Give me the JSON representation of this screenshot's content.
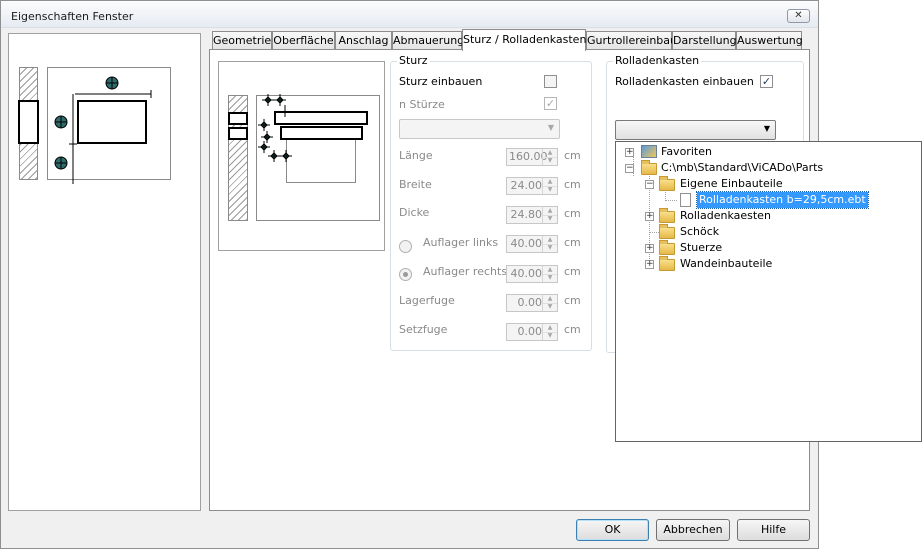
{
  "window": {
    "title": "Eigenschaften Fenster",
    "close_glyph": "✕"
  },
  "tabs": [
    {
      "label": "Geometrie"
    },
    {
      "label": "Oberfläche"
    },
    {
      "label": "Anschlag"
    },
    {
      "label": "Abmauerung"
    },
    {
      "label": "Sturz / Rolladenkasten",
      "active": true
    },
    {
      "label": "Gurtrollereinbau"
    },
    {
      "label": "Darstellung"
    },
    {
      "label": "Auswertung"
    }
  ],
  "sturz": {
    "title": "Sturz",
    "sturz_einbauen": {
      "label": "Sturz einbauen",
      "checked": false
    },
    "n_stuerze": {
      "label": "n Stürze",
      "checked": true,
      "disabled": true
    },
    "combo_value": "",
    "fields": [
      {
        "label": "Länge",
        "value": "160.00",
        "unit": "cm"
      },
      {
        "label": "Breite",
        "value": "24.00",
        "unit": "cm"
      },
      {
        "label": "Dicke",
        "value": "24.80",
        "unit": "cm"
      },
      {
        "label": "Auflager links",
        "value": "40.00",
        "unit": "cm",
        "radio": true,
        "selected": false
      },
      {
        "label": "Auflager rechts",
        "value": "40.00",
        "unit": "cm",
        "radio": true,
        "selected": true
      },
      {
        "label": "Lagerfuge",
        "value": "0.00",
        "unit": "cm"
      },
      {
        "label": "Setzfuge",
        "value": "0.00",
        "unit": "cm"
      }
    ]
  },
  "rolladenkasten": {
    "title": "Rolladenkasten",
    "einbauen": {
      "label": "Rolladenkasten einbauen",
      "checked": true
    },
    "combo_value": ""
  },
  "tree": [
    {
      "label": "Favoriten",
      "icon": "favorites-icon",
      "expander": "+"
    },
    {
      "label": "C:\\mb\\Standard\\ViCADo\\Parts",
      "icon": "folder-icon",
      "expander": "−"
    },
    {
      "label": "Eigene Einbauteile",
      "icon": "folder-icon",
      "expander": "−"
    },
    {
      "label": "Rolladenkasten b=29,5cm.ebt",
      "icon": "file-icon",
      "selected": true
    },
    {
      "label": "Rolladenkaesten",
      "icon": "folder-icon",
      "expander": "+"
    },
    {
      "label": "Schöck",
      "icon": "folder-icon"
    },
    {
      "label": "Stuerze",
      "icon": "folder-icon",
      "expander": "+"
    },
    {
      "label": "Wandeinbauteile",
      "icon": "folder-icon",
      "expander": "+"
    }
  ],
  "buttons": {
    "ok": "OK",
    "cancel": "Abbrechen",
    "help": "Hilfe"
  },
  "colors": {
    "accent_selection": "#3399ff",
    "marker_fill": "#2f6b6b"
  }
}
